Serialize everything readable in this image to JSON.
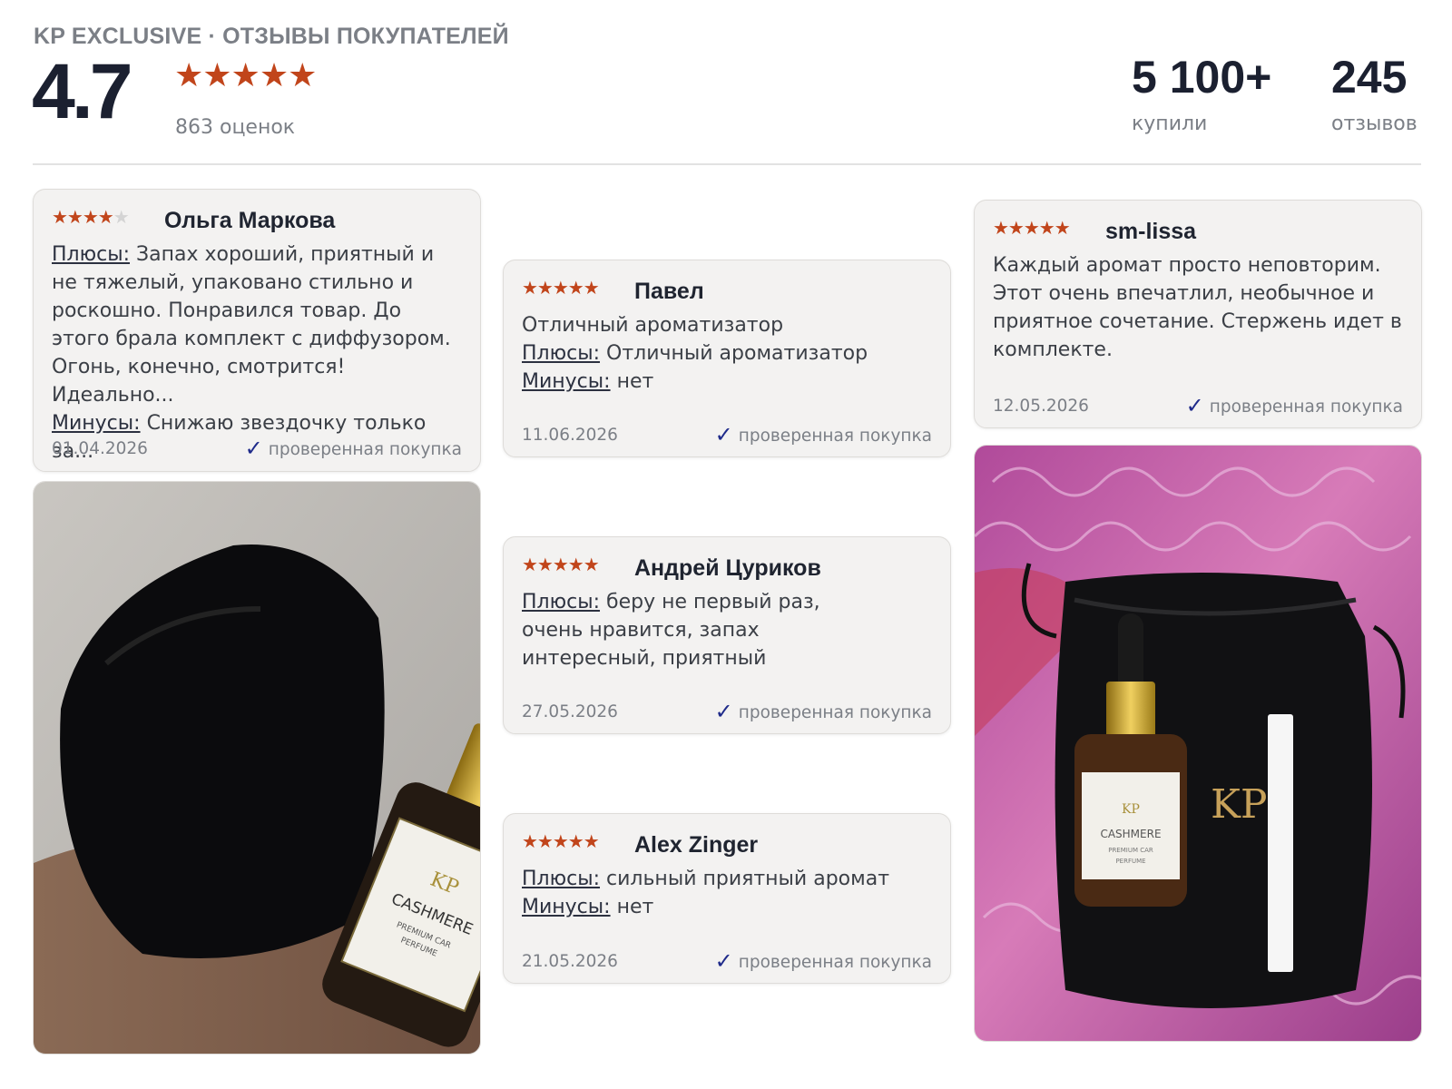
{
  "header": {
    "brand": "KP EXCLUSIVE · ОТЗЫВЫ ПОКУПАТЕЛЕЙ",
    "rating": "4.7",
    "stars": "★★★★★",
    "ratings_count": "863 оценок",
    "stats": [
      {
        "value": "5 100+",
        "label": "купили"
      },
      {
        "value": "245",
        "label": "отзывов"
      }
    ]
  },
  "colors": {
    "star": "#c1451b",
    "star_off": "#d4d4d4",
    "check": "#1e2a8a",
    "card_bg": "#f3f2f1"
  },
  "reviews": [
    {
      "author": "Ольга Маркова",
      "rating": 4,
      "stars_on": "★★★★",
      "stars_off": "★",
      "pros_label": "Плюсы:",
      "pros": "Запах хороший, приятный и не тяжелый, упаковано стильно и роскошно. Понравился товар. До этого брала комплект с диффузором. Огонь, конечно, смотрится! Идеально...",
      "cons_label": "Минусы:",
      "cons": "Снижаю звездочку только за...",
      "date": "01.04.2026",
      "verified": "проверенная покупка"
    },
    {
      "author": "Павел",
      "rating": 5,
      "stars_on": "★★★★★",
      "text": "Отличный ароматизатор",
      "pros_label": "Плюсы:",
      "pros": "Отличный ароматизатор",
      "cons_label": "Минусы:",
      "cons": "нет",
      "date": "11.06.2026",
      "verified": "проверенная покупка"
    },
    {
      "author": "Андрей Цуриков",
      "rating": 5,
      "stars_on": "★★★★★",
      "pros_label": "Плюсы:",
      "pros": "беру не первый раз, очень нравится, запах интересный, приятный",
      "date": "27.05.2026",
      "verified": "проверенная покупка"
    },
    {
      "author": "Alex Zinger",
      "rating": 5,
      "stars_on": "★★★★★",
      "pros_label": "Плюсы:",
      "pros": "сильный приятный аромат",
      "cons_label": "Минусы:",
      "cons": "нет",
      "date": "21.05.2026",
      "verified": "проверенная покупка"
    },
    {
      "author": "sm-lissa",
      "rating": 5,
      "stars_on": "★★★★★",
      "text": "Каждый аромат просто неповторим. Этот очень впечатлил, необычное и приятное сочетание. Стержень идет в комплекте.",
      "date": "12.05.2026",
      "verified": "проверенная покупка"
    }
  ],
  "photos": [
    {
      "logo": "KP",
      "label_name": "CASHMERE",
      "label_sub1": "PREMIUM CAR",
      "label_sub2": "PERFUME"
    },
    {
      "logo": "KP",
      "label_name": "CASHMERE",
      "label_sub1": "PREMIUM CAR",
      "label_sub2": "PERFUME"
    }
  ]
}
